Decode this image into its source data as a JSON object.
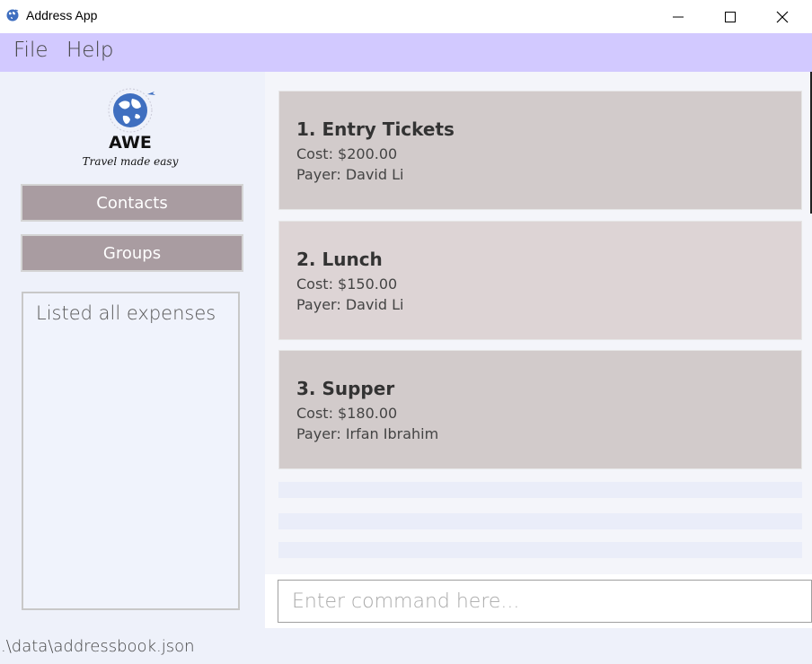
{
  "window": {
    "title": "Address App",
    "icon": "globe-icon"
  },
  "menu": {
    "file": "File",
    "help": "Help"
  },
  "logo": {
    "text": "AWE",
    "tagline": "Travel made easy"
  },
  "nav": {
    "contacts": "Contacts",
    "groups": "Groups"
  },
  "result": {
    "text": "Listed all expenses"
  },
  "expenses": [
    {
      "title": "1. Entry Tickets",
      "cost": "Cost: $200.00",
      "payer": "Payer: David Li"
    },
    {
      "title": "2. Lunch",
      "cost": "Cost: $150.00",
      "payer": "Payer: David Li"
    },
    {
      "title": "3. Supper",
      "cost": "Cost: $180.00",
      "payer": "Payer: Irfan Ibrahim"
    }
  ],
  "command": {
    "placeholder": "Enter command here..."
  },
  "status": {
    "path": ".\\data\\addressbook.json"
  },
  "colors": {
    "menu_bg": "#d2c9ff",
    "nav_button": "#a99ca1",
    "card_odd": "#d2cbcb",
    "card_even": "#ddd4d5",
    "panel_bg": "#eef1fa"
  }
}
